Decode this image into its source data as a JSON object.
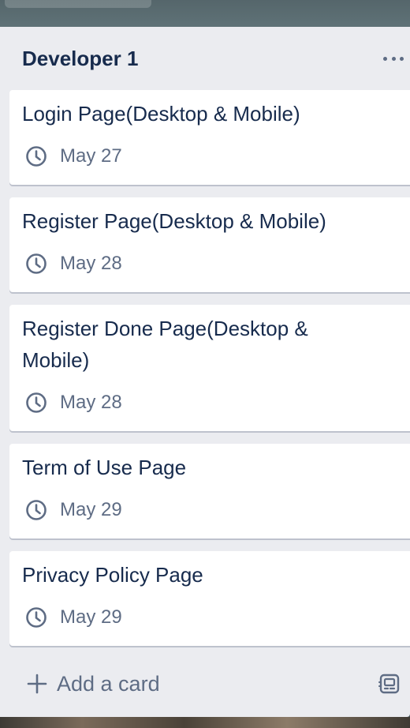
{
  "list": {
    "title": "Developer 1",
    "menu_icon": "more-horizontal-icon",
    "cards": [
      {
        "title": "Login Page(Desktop & Mobile)",
        "due": "May 27"
      },
      {
        "title": "Register Page(Desktop & Mobile)",
        "due": "May 28"
      },
      {
        "title": "Register Done Page(Desktop & Mobile)",
        "due": "May 28"
      },
      {
        "title": "Term of Use Page",
        "due": "May 29"
      },
      {
        "title": "Privacy Policy Page",
        "due": "May 29"
      }
    ],
    "add_card_label": "Add a card",
    "template_icon": "card-template-icon"
  },
  "colors": {
    "list_bg": "#ebecf0",
    "card_bg": "#ffffff",
    "title_text": "#172b4d",
    "muted_text": "#5e6c84"
  }
}
